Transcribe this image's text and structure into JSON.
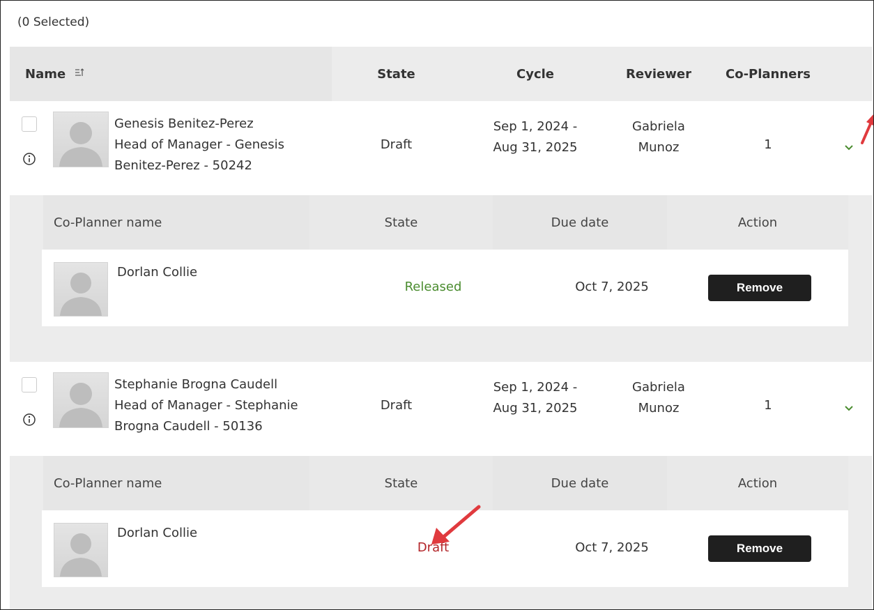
{
  "selection": {
    "count_label": "(0 Selected)"
  },
  "columns": {
    "name": "Name",
    "state": "State",
    "cycle": "Cycle",
    "reviewer": "Reviewer",
    "co_planners": "Co-Planners"
  },
  "sub_columns": {
    "name": "Co-Planner name",
    "state": "State",
    "due_date": "Due date",
    "action": "Action"
  },
  "plans": [
    {
      "name": "Genesis Benitez-Perez",
      "title_line1": "Head of Manager - Genesis",
      "title_line2": "Benitez-Perez - 50242",
      "state": "Draft",
      "cycle_line1": "Sep 1, 2024 -",
      "cycle_line2": "Aug 31, 2025",
      "reviewer_line1": "Gabriela",
      "reviewer_line2": "Munoz",
      "co_planners_count": "1",
      "co_planners": [
        {
          "name": "Dorlan Collie",
          "state": "Released",
          "state_color": "#4a8c2f",
          "due_date": "Oct 7, 2025",
          "action_label": "Remove"
        }
      ]
    },
    {
      "name": "Stephanie Brogna Caudell",
      "title_line1": "Head of Manager - Stephanie",
      "title_line2": "Brogna Caudell - 50136",
      "state": "Draft",
      "cycle_line1": "Sep 1, 2024 -",
      "cycle_line2": "Aug 31, 2025",
      "reviewer_line1": "Gabriela",
      "reviewer_line2": "Munoz",
      "co_planners_count": "1",
      "co_planners": [
        {
          "name": "Dorlan Collie",
          "state": "Draft",
          "state_color": "#b3262a",
          "due_date": "Oct 7, 2025",
          "action_label": "Remove"
        }
      ]
    }
  ],
  "colors": {
    "accent_green": "#4a8c2f",
    "draft_red": "#b3262a",
    "annotation_arrow": "#e03a3e",
    "button_dark": "#1f1f1f"
  },
  "icons": {
    "sort": "sort-icon",
    "info": "info-icon",
    "chevron": "chevron-down-icon"
  }
}
